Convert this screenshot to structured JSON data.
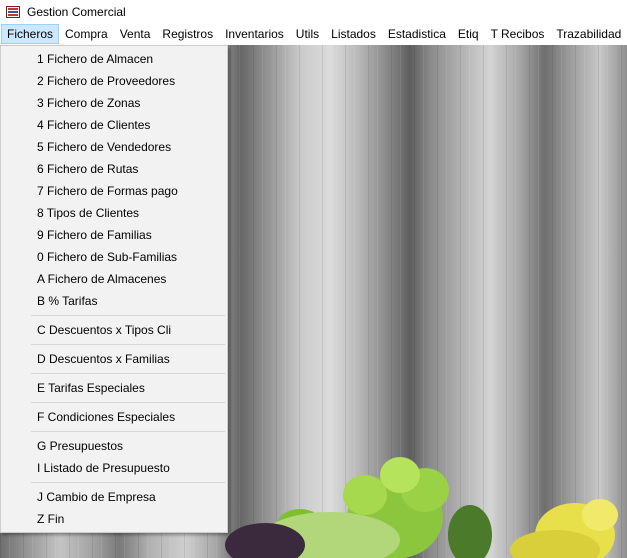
{
  "window": {
    "title": "Gestion Comercial",
    "icon": "app-icon"
  },
  "menubar": {
    "items": [
      "Ficheros",
      "Compra",
      "Venta",
      "Registros",
      "Inventarios",
      "Utils",
      "Listados",
      "Estadistica",
      "Etiq",
      "T Recibos",
      "Trazabilidad"
    ],
    "active": "Ficheros"
  },
  "ficheros_menu": {
    "groups": [
      [
        "1 Fichero de Almacen",
        "2 Fichero de Proveedores",
        "3 Fichero de Zonas",
        "4 Fichero de Clientes",
        "5 Fichero de Vendedores",
        "6 Fichero de Rutas",
        "7 Fichero de Formas pago",
        "8 Tipos de Clientes",
        "9 Fichero de Familias",
        "0 Fichero de Sub-Familias",
        "A Fichero de Almacenes",
        "B % Tarifas"
      ],
      [
        "C Descuentos x Tipos Cli"
      ],
      [
        "D Descuentos x Familias"
      ],
      [
        "E Tarifas Especiales"
      ],
      [
        "F Condiciones Especiales"
      ],
      [
        "G Presupuestos",
        "I Listado de Presupuesto"
      ],
      [
        "J Cambio de Empresa",
        "Z Fin"
      ]
    ]
  },
  "colors": {
    "menu_active_bg": "#cce8ff",
    "menu_active_border": "#99d1ff",
    "dropdown_bg": "#f2f2f2"
  }
}
